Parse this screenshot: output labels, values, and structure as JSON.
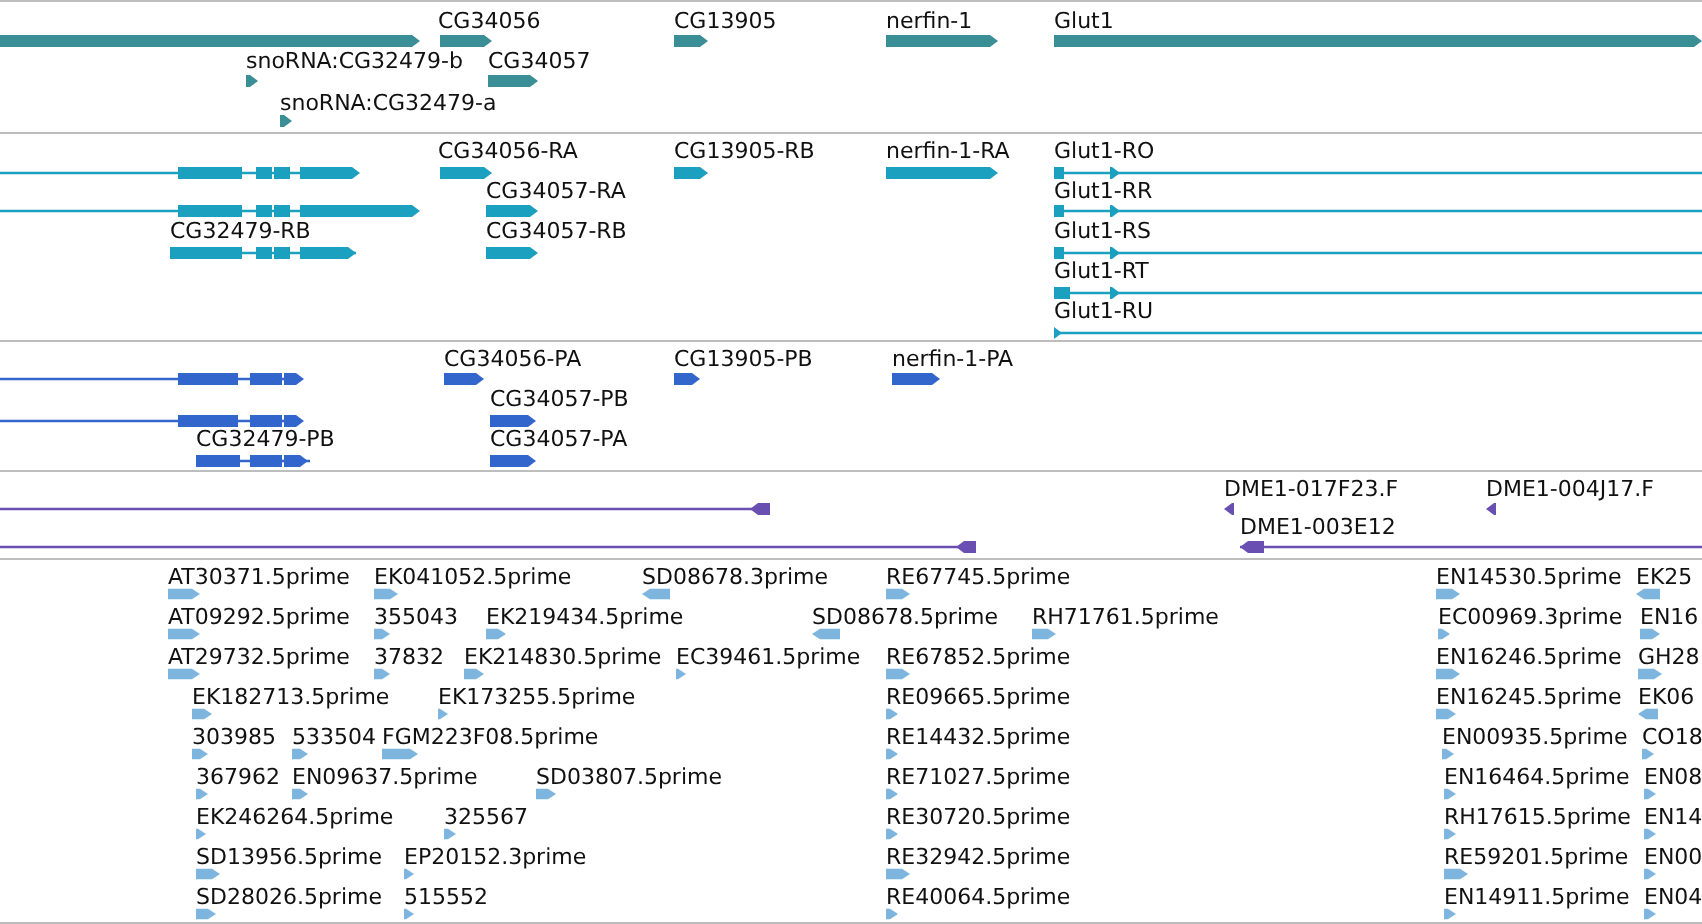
{
  "tracks": [
    {
      "kind": "gene",
      "color": "#3a8f96",
      "features": [
        {
          "reverse": false
        },
        {
          "label": "CG34056",
          "reverse": false
        },
        {
          "label": "snoRNA:CG32479-b",
          "reverse": false
        },
        {
          "label": "CG34057",
          "reverse": false
        },
        {
          "label": "snoRNA:CG32479-a",
          "reverse": false
        },
        {
          "label": "CG13905",
          "reverse": false
        },
        {
          "label": "nerfin-1",
          "reverse": false
        },
        {
          "label": "Glut1",
          "reverse": false
        }
      ]
    },
    {
      "kind": "transcript",
      "color": "#1ba0bf",
      "features": [
        {
          "reverse": false
        },
        {
          "reverse": false
        },
        {
          "label": "CG32479-RB",
          "reverse": false
        },
        {
          "label": "CG34056-RA",
          "reverse": false
        },
        {
          "label": "CG34057-RA",
          "reverse": false
        },
        {
          "label": "CG34057-RB",
          "reverse": false
        },
        {
          "label": "CG13905-RB",
          "reverse": false
        },
        {
          "label": "nerfin-1-RA",
          "reverse": false
        },
        {
          "label": "Glut1-RO",
          "reverse": false
        },
        {
          "label": "Glut1-RR",
          "reverse": false
        },
        {
          "label": "Glut1-RS",
          "reverse": false
        },
        {
          "label": "Glut1-RT",
          "reverse": false
        },
        {
          "label": "Glut1-RU",
          "reverse": false
        }
      ]
    },
    {
      "kind": "protein",
      "color": "#3366cc",
      "features": [
        {
          "reverse": false
        },
        {
          "reverse": false
        },
        {
          "label": "CG32479-PB",
          "reverse": false
        },
        {
          "label": "CG34056-PA",
          "reverse": false
        },
        {
          "label": "CG34057-PB",
          "reverse": false
        },
        {
          "label": "CG34057-PA",
          "reverse": false
        },
        {
          "label": "CG13905-PB",
          "reverse": false
        },
        {
          "label": "nerfin-1-PA",
          "reverse": false
        }
      ]
    },
    {
      "kind": "clone",
      "color": "#6a4fb3",
      "features": [
        {
          "reverse": true
        },
        {
          "reverse": true
        },
        {
          "label": "DME1-017F23.F",
          "reverse": true
        },
        {
          "label": "DME1-004J17.F",
          "reverse": true
        },
        {
          "label": "DME1-003E12",
          "reverse": true
        }
      ]
    },
    {
      "kind": "est",
      "color": "#7db5de",
      "features": [
        {
          "label": "AT30371.5prime",
          "reverse": false
        },
        {
          "label": "EK041052.5prime",
          "reverse": false
        },
        {
          "label": "SD08678.3prime",
          "reverse": true
        },
        {
          "label": "RE67745.5prime",
          "reverse": false
        },
        {
          "label": "EN14530.5prime",
          "reverse": false
        },
        {
          "label": "EK25",
          "reverse": true
        },
        {
          "label": "AT09292.5prime",
          "reverse": false
        },
        {
          "label": "355043",
          "reverse": false
        },
        {
          "label": "EK219434.5prime",
          "reverse": false
        },
        {
          "label": "SD08678.5prime",
          "reverse": true
        },
        {
          "label": "RH71761.5prime",
          "reverse": false
        },
        {
          "label": "EC00969.3prime",
          "reverse": false
        },
        {
          "label": "EN16",
          "reverse": false
        },
        {
          "label": "AT29732.5prime",
          "reverse": false
        },
        {
          "label": "37832",
          "reverse": false
        },
        {
          "label": "EK214830.5prime",
          "reverse": false
        },
        {
          "label": "EC39461.5prime",
          "reverse": false
        },
        {
          "label": "RE67852.5prime",
          "reverse": false
        },
        {
          "label": "EN16246.5prime",
          "reverse": false
        },
        {
          "label": "GH28",
          "reverse": false
        },
        {
          "label": "EK182713.5prime",
          "reverse": false
        },
        {
          "label": "EK173255.5prime",
          "reverse": false
        },
        {
          "label": "RE09665.5prime",
          "reverse": false
        },
        {
          "label": "EN16245.5prime",
          "reverse": false
        },
        {
          "label": "EK06",
          "reverse": true
        },
        {
          "label": "303985",
          "reverse": false
        },
        {
          "label": "533504",
          "reverse": false
        },
        {
          "label": "FGM223F08.5prime",
          "reverse": false
        },
        {
          "label": "RE14432.5prime",
          "reverse": false
        },
        {
          "label": "EN00935.5prime",
          "reverse": false
        },
        {
          "label": "CO18",
          "reverse": false
        },
        {
          "label": "367962",
          "reverse": false
        },
        {
          "label": "EN09637.5prime",
          "reverse": false
        },
        {
          "label": "SD03807.5prime",
          "reverse": false
        },
        {
          "label": "RE71027.5prime",
          "reverse": false
        },
        {
          "label": "EN16464.5prime",
          "reverse": false
        },
        {
          "label": "EN08",
          "reverse": false
        },
        {
          "label": "EK246264.5prime",
          "reverse": false
        },
        {
          "label": "325567",
          "reverse": false
        },
        {
          "label": "RE30720.5prime",
          "reverse": false
        },
        {
          "label": "RH17615.5prime",
          "reverse": false
        },
        {
          "label": "EN14",
          "reverse": false
        },
        {
          "label": "SD13956.5prime",
          "reverse": false
        },
        {
          "label": "EP20152.3prime",
          "reverse": false
        },
        {
          "label": "RE32942.5prime",
          "reverse": false
        },
        {
          "label": "RE59201.5prime",
          "reverse": false
        },
        {
          "label": "EN00",
          "reverse": false
        },
        {
          "label": "SD28026.5prime",
          "reverse": false
        },
        {
          "label": "515552",
          "reverse": false
        },
        {
          "label": "RE40064.5prime",
          "reverse": false
        },
        {
          "label": "EN14911.5prime",
          "reverse": false
        },
        {
          "label": "EN04",
          "reverse": false
        }
      ]
    }
  ]
}
